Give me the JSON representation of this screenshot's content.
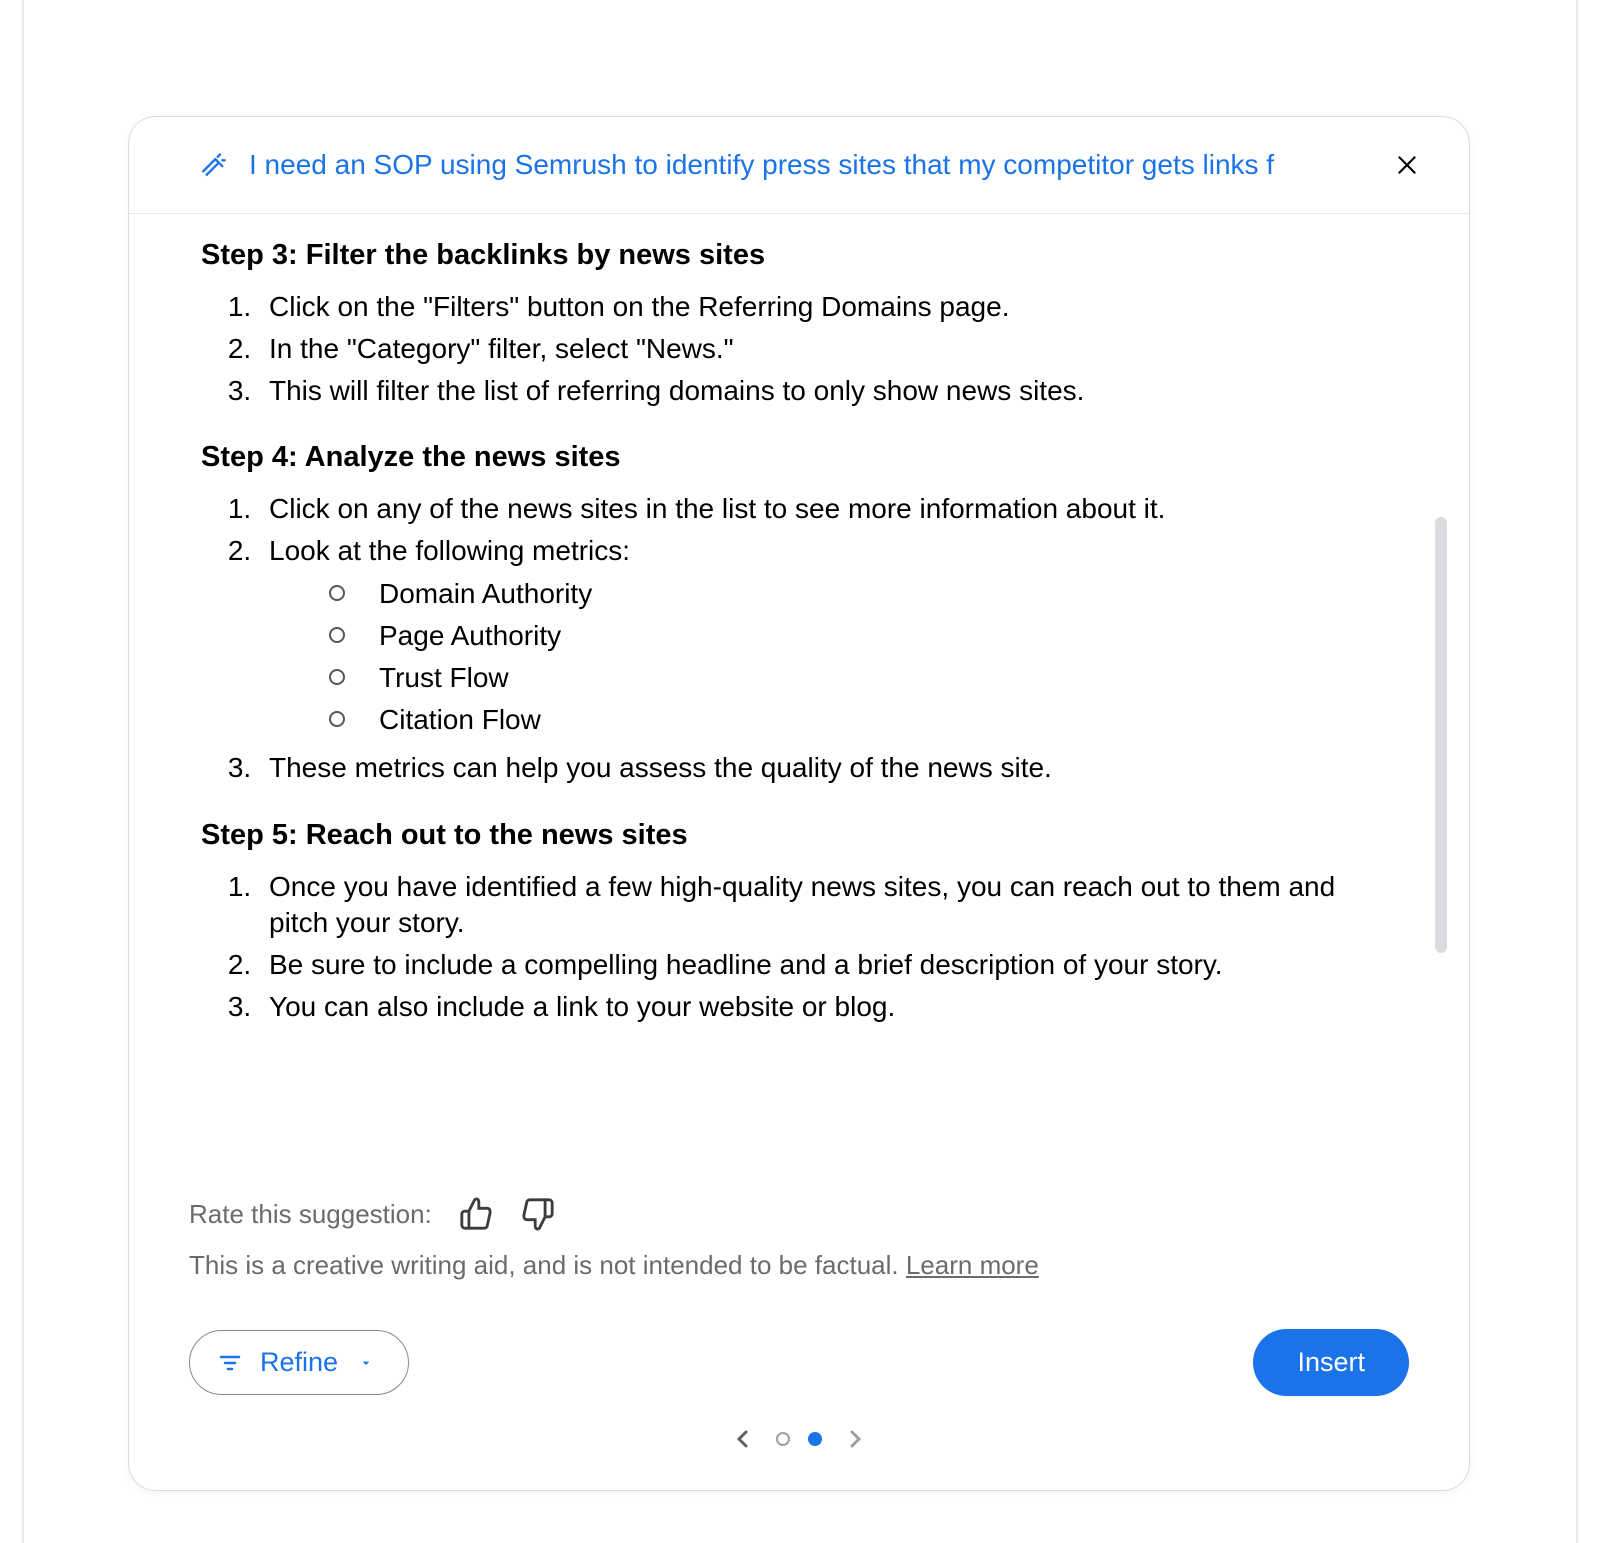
{
  "header": {
    "prompt": "I need an SOP using Semrush to identify press sites that my competitor gets links f"
  },
  "content": {
    "step3": {
      "heading": "Step 3: Filter the backlinks by news sites",
      "items": [
        "Click on the \"Filters\" button on the Referring Domains page.",
        "In the \"Category\" filter, select \"News.\"",
        "This will filter the list of referring domains to only show news sites."
      ]
    },
    "step4": {
      "heading": "Step 4: Analyze the news sites",
      "items": [
        "Click on any of the news sites in the list to see more information about it.",
        "Look at the following metrics:",
        "These metrics can help you assess the quality of the news site."
      ],
      "metrics": [
        "Domain Authority",
        "Page Authority",
        "Trust Flow",
        "Citation Flow"
      ]
    },
    "step5": {
      "heading": "Step 5: Reach out to the news sites",
      "items": [
        "Once you have identified a few high-quality news sites, you can reach out to them and pitch your story.",
        "Be sure to include a compelling headline and a brief description of your story.",
        "You can also include a link to your website or blog."
      ]
    }
  },
  "footer": {
    "rate_label": "Rate this suggestion:",
    "disclaimer": "This is a creative writing aid, and is not intended to be factual. ",
    "learn_more": "Learn more",
    "refine_label": "Refine",
    "insert_label": "Insert"
  }
}
